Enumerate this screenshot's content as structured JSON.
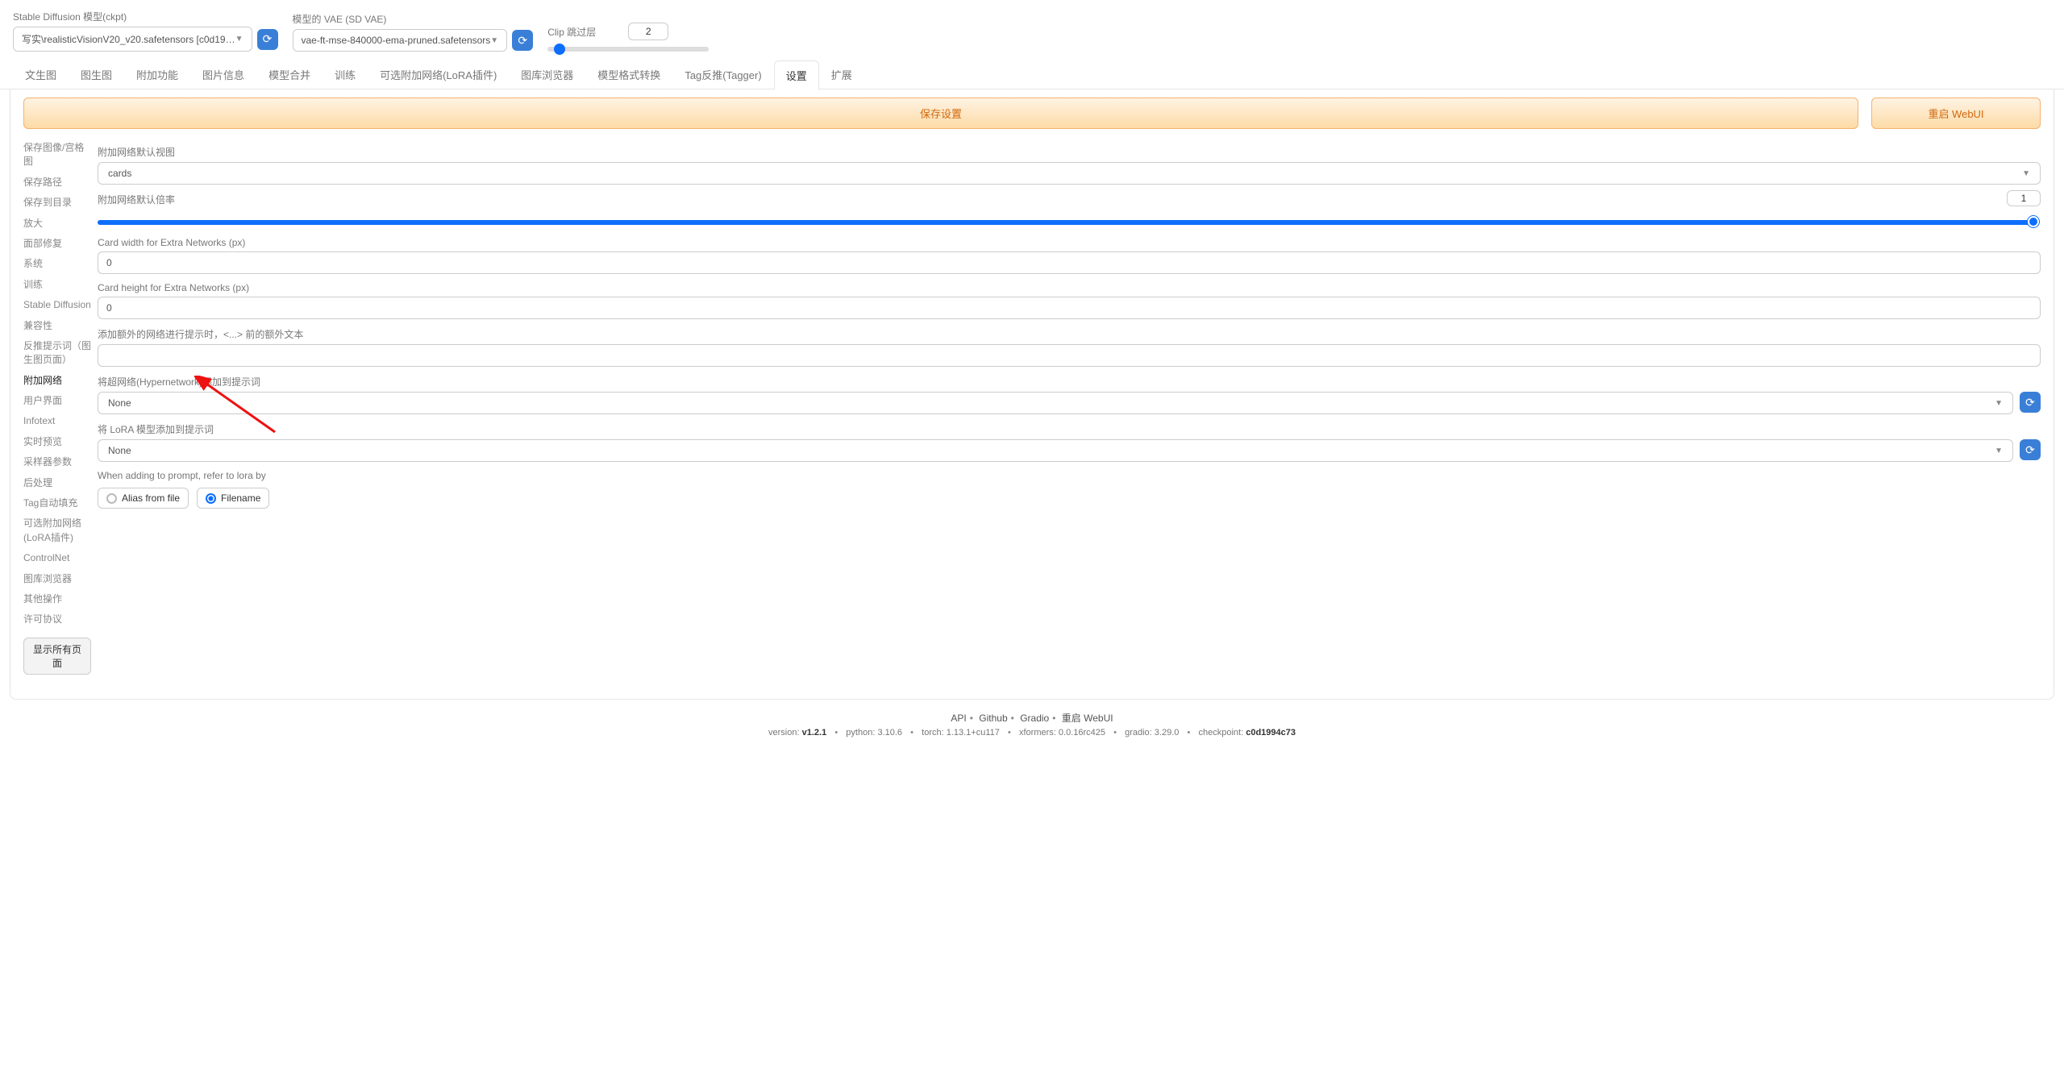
{
  "header": {
    "ckpt_label": "Stable Diffusion 模型(ckpt)",
    "ckpt_value": "写实\\realisticVisionV20_v20.safetensors [c0d19…",
    "vae_label": "模型的 VAE (SD VAE)",
    "vae_value": "vae-ft-mse-840000-ema-pruned.safetensors",
    "clip_label": "Clip 跳过层",
    "clip_value": "2"
  },
  "tabs": [
    "文生图",
    "图生图",
    "附加功能",
    "图片信息",
    "模型合并",
    "训练",
    "可选附加网络(LoRA插件)",
    "图库浏览器",
    "模型格式转换",
    "Tag反推(Tagger)",
    "设置",
    "扩展"
  ],
  "active_tab": "设置",
  "actions": {
    "save": "保存设置",
    "restart": "重启 WebUI"
  },
  "sidebar": {
    "items": [
      "保存图像/宫格图",
      "保存路径",
      "保存到目录",
      "放大",
      "面部修复",
      "系统",
      "训练",
      "Stable Diffusion",
      "兼容性",
      "反推提示词（图生图页面）",
      "附加网络",
      "用户界面",
      "Infotext",
      "实时预览",
      "采样器参数",
      "后处理",
      "Tag自动填充",
      "可选附加网络(LoRA插件)",
      "ControlNet",
      "图库浏览器",
      "其他操作",
      "许可协议"
    ],
    "active": "附加网络",
    "show_all": "显示所有页面"
  },
  "fields": {
    "default_view_label": "附加网络默认视图",
    "default_view_value": "cards",
    "multiplier_label": "附加网络默认倍率",
    "multiplier_value": "1",
    "card_width_label": "Card width for Extra Networks (px)",
    "card_width_value": "0",
    "card_height_label": "Card height for Extra Networks (px)",
    "card_height_value": "0",
    "extra_text_label": "添加额外的网络进行提示时，<...> 前的额外文本",
    "extra_text_value": "",
    "hypernet_label": "将超网络(Hypernetwork)添加到提示词",
    "hypernet_value": "None",
    "lora_label": "将 LoRA 模型添加到提示词",
    "lora_value": "None",
    "refer_label": "When adding to prompt, refer to lora by",
    "radio_alias": "Alias from file",
    "radio_filename": "Filename"
  },
  "footer": {
    "links": [
      "API",
      "Github",
      "Gradio",
      "重启 WebUI"
    ],
    "version_label": "version:",
    "version": "v1.2.1",
    "python_label": "python:",
    "python": "3.10.6",
    "torch_label": "torch:",
    "torch": "1.13.1+cu117",
    "xformers_label": "xformers:",
    "xformers": "0.0.16rc425",
    "gradio_label": "gradio:",
    "gradio": "3.29.0",
    "checkpoint_label": "checkpoint:",
    "checkpoint": "c0d1994c73"
  }
}
